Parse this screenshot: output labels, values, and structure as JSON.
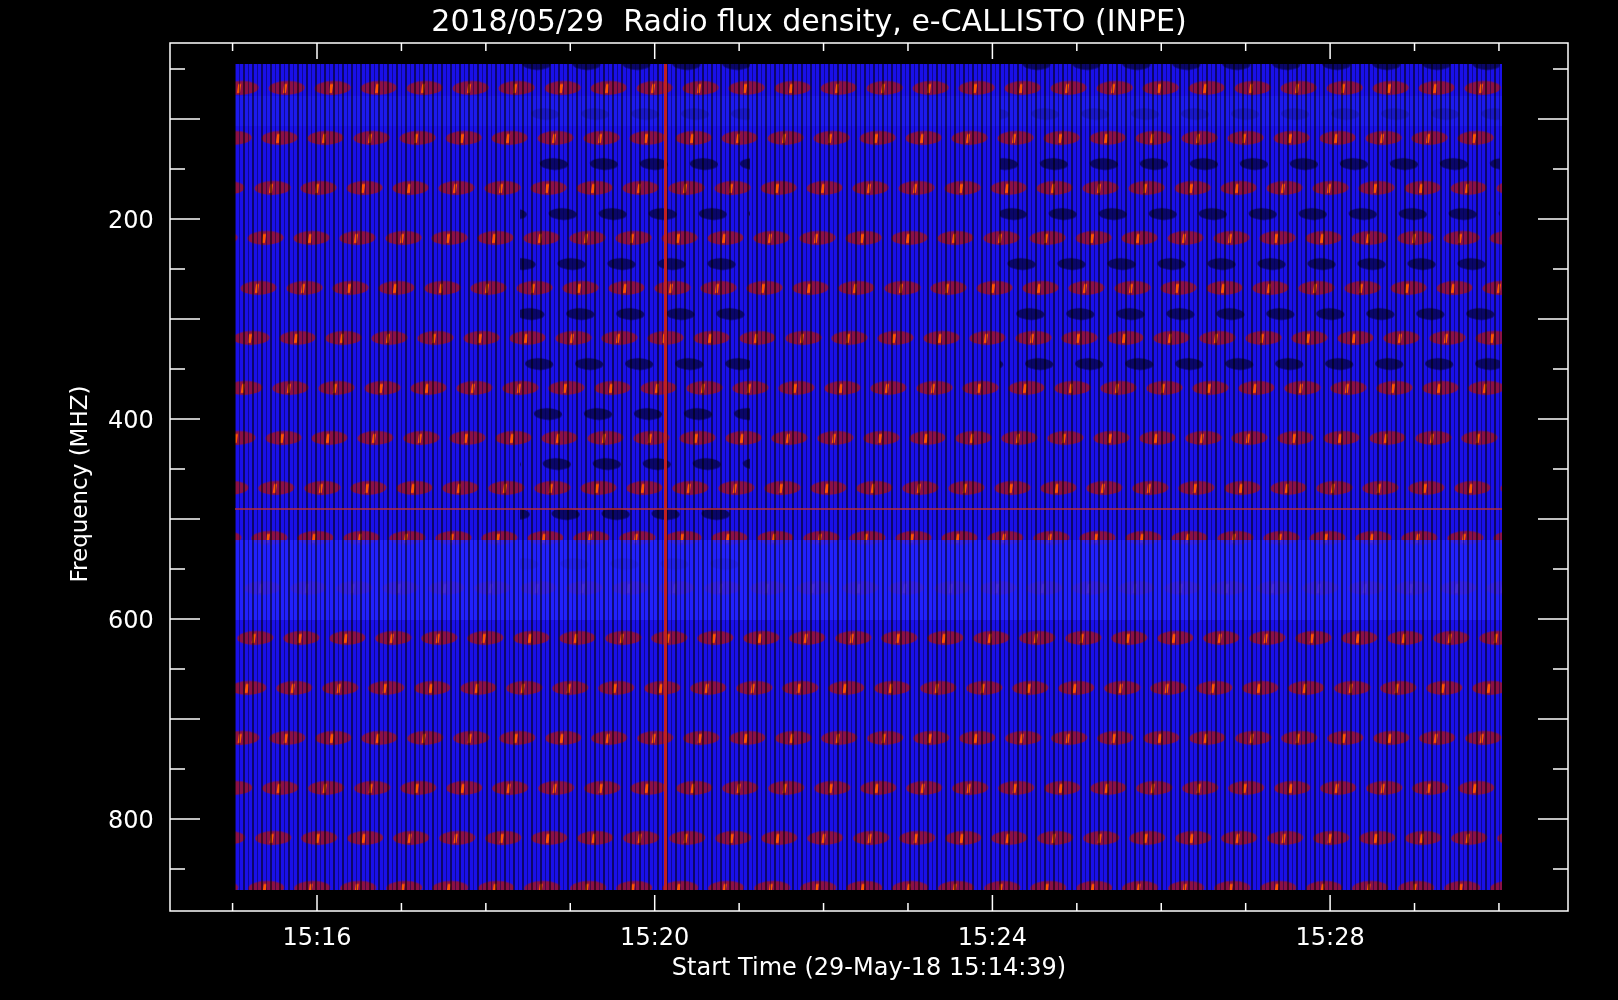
{
  "title": "2018/05/29  Radio flux density, e-CALLISTO (INPE)",
  "plot": {
    "ylabel": "Frequency (MHZ)",
    "xlabel": "Start Time (29-May-18 15:14:39)",
    "xticks": [
      "15:16",
      "15:20",
      "15:24",
      "15:28"
    ],
    "yticks": [
      "200",
      "400",
      "600",
      "800"
    ]
  }
}
